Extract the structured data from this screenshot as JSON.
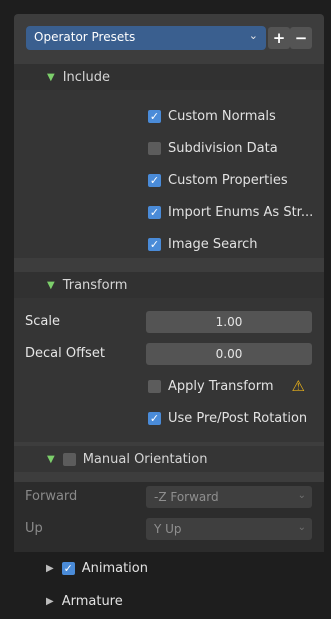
{
  "presets": {
    "label": "Operator Presets",
    "chevron": "⌄",
    "add_icon": "+",
    "remove_icon": "−"
  },
  "include": {
    "title": "Include",
    "items": [
      {
        "label": "Custom Normals",
        "checked": true
      },
      {
        "label": "Subdivision Data",
        "checked": false
      },
      {
        "label": "Custom Properties",
        "checked": true
      },
      {
        "label": "Import Enums As Str...",
        "checked": true
      },
      {
        "label": "Image Search",
        "checked": true
      }
    ]
  },
  "transform": {
    "title": "Transform",
    "scale_label": "Scale",
    "scale_value": "1.00",
    "decal_label": "Decal Offset",
    "decal_value": "0.00",
    "apply_label": "Apply Transform",
    "apply_checked": false,
    "rotation_label": "Use Pre/Post Rotation",
    "rotation_checked": true
  },
  "manual_orientation": {
    "title": "Manual Orientation",
    "checked": false,
    "forward_label": "Forward",
    "forward_value": "-Z Forward",
    "up_label": "Up",
    "up_value": "Y Up"
  },
  "animation": {
    "title": "Animation",
    "checked": true
  },
  "armature": {
    "title": "Armature"
  },
  "colors": {
    "accent": "#4a8bd8",
    "warning": "#e8b11a",
    "expanded_arrow": "#7ccf6b"
  }
}
